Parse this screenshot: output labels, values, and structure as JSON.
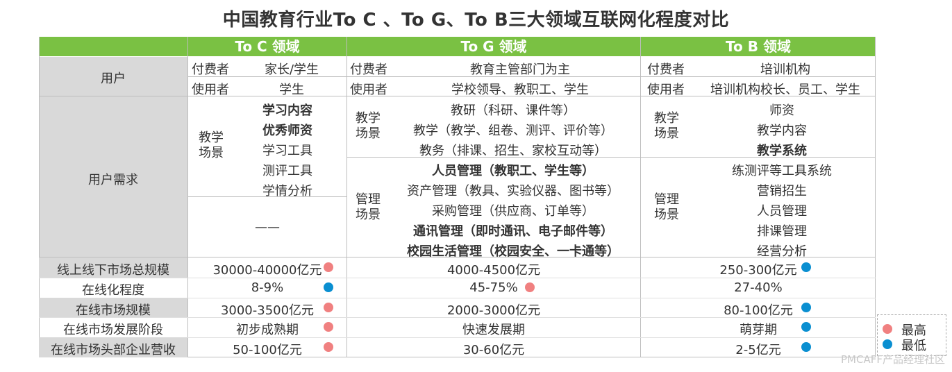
{
  "title": "中国教育行业To C 、To G、To B三大领域互联网化程度对比",
  "headers": [
    "To C 领域",
    "To G 领域",
    "To B 领域"
  ],
  "user": {
    "label": "用户",
    "toc": {
      "payer_k": "付费者",
      "payer_v": "家长/学生",
      "userk": "使用者",
      "userv": "学生"
    },
    "tog": {
      "payer_k": "付费者",
      "payer_v": "教育主管部门为主",
      "userk": "使用者",
      "userv": "学校领导、教职工、学生"
    },
    "tob": {
      "payer_k": "付费者",
      "payer_v": "培训机构",
      "userk": "使用者",
      "userv": "培训机构校长、员工、学生"
    }
  },
  "needs": {
    "label": "用户需求",
    "toc": {
      "scene": "教学场景",
      "items": [
        "学习内容",
        "优秀师资",
        "学习工具",
        "测评工具",
        "学情分析"
      ],
      "dash": "——"
    },
    "tog": {
      "teach_scene": "教学场景",
      "teach_items": [
        "教研（科研、课件等）",
        "教学（教学、组卷、测评、评价等）",
        "教务（排课、招生、家校互动等）"
      ],
      "mgmt_scene": "管理场景",
      "mgmt_items": [
        "人员管理（教职工、学生等）",
        "资产管理（教具、实验仪器、图书等）",
        "采购管理（供应商、订单等）",
        "通讯管理（即时通讯、电子邮件等）",
        "校园生活管理（校园安全、一卡通等）"
      ]
    },
    "tob": {
      "teach_scene": "教学场景",
      "teach_items": [
        "师资",
        "教学内容",
        "教学系统"
      ],
      "mgmt_scene": "管理场景",
      "mgmt_items": [
        "练测评等工具系统",
        "营销招生",
        "人员管理",
        "排课管理",
        "经营分析"
      ]
    }
  },
  "metrics": [
    {
      "label": "线上线下市场总规模",
      "toc": "30000-40000亿元",
      "tog": "4000-4500亿元",
      "tob": "250-300亿元",
      "toc_dot": "high",
      "tog_dot": "",
      "tob_dot": "low"
    },
    {
      "label": "在线化程度",
      "toc": "8-9%",
      "tog": "45-75%",
      "tob": "27-40%",
      "toc_dot": "low",
      "tog_dot": "high",
      "tob_dot": ""
    },
    {
      "label": "在线市场规模",
      "toc": "3000-3500亿元",
      "tog": "2000-3000亿元",
      "tob": "80-100亿元",
      "toc_dot": "high",
      "tog_dot": "",
      "tob_dot": "low"
    },
    {
      "label": "在线市场发展阶段",
      "toc": "初步成熟期",
      "tog": "快速发展期",
      "tob": "萌芽期",
      "toc_dot": "high",
      "tog_dot": "",
      "tob_dot": "low"
    },
    {
      "label": "在线市场头部企业营收",
      "toc": "50-100亿元",
      "tog": "30-60亿元",
      "tob": "2-5亿元",
      "toc_dot": "high",
      "tog_dot": "",
      "tob_dot": "low"
    }
  ],
  "legend": {
    "high": "最高",
    "low": "最低"
  },
  "colors": {
    "header_green": "#7ac143",
    "high": "#f08080",
    "low": "#0a8fd1",
    "grey": "#d9d9d9"
  },
  "watermark": "PMCAFF产品经理社区"
}
